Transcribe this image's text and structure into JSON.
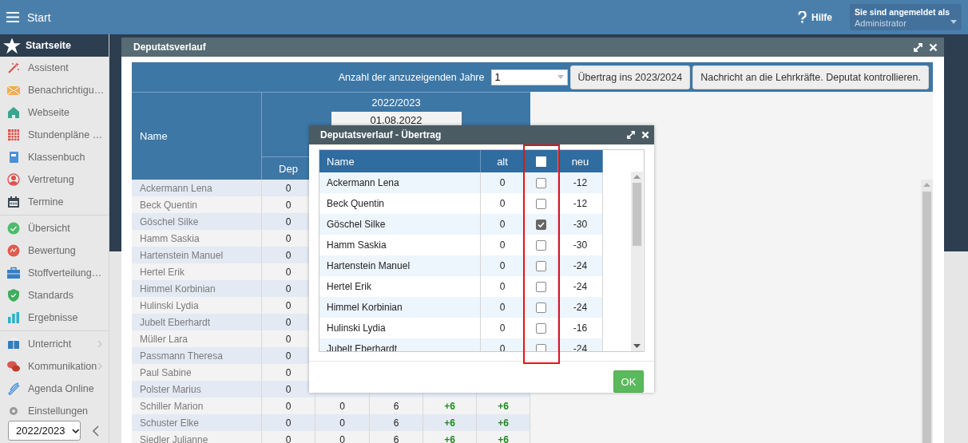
{
  "top_bar": {
    "title": "Start",
    "help": "Hilfe",
    "user_label": "Sie sind angemeldet als",
    "user_name": "Administrator"
  },
  "sidebar": {
    "groups": [
      [
        {
          "label": "Startseite",
          "selected": true,
          "has_submenu": false
        }
      ],
      [
        {
          "label": "Assistent",
          "selected": false,
          "has_submenu": false
        },
        {
          "label": "Benachrichtigu…",
          "selected": false,
          "has_submenu": false
        },
        {
          "label": "Webseite",
          "selected": false,
          "has_submenu": false
        },
        {
          "label": "Stundenpläne …",
          "selected": false,
          "has_submenu": false
        },
        {
          "label": "Klassenbuch",
          "selected": false,
          "has_submenu": false
        },
        {
          "label": "Vertretung",
          "selected": false,
          "has_submenu": false
        },
        {
          "label": "Termine",
          "selected": false,
          "has_submenu": false
        }
      ],
      [
        {
          "label": "Übersicht",
          "selected": false,
          "has_submenu": false
        },
        {
          "label": "Bewertung",
          "selected": false,
          "has_submenu": false
        },
        {
          "label": "Stoffverteilung…",
          "selected": false,
          "has_submenu": false
        },
        {
          "label": "Standards",
          "selected": false,
          "has_submenu": false
        },
        {
          "label": "Ergebnisse",
          "selected": false,
          "has_submenu": false
        }
      ],
      [
        {
          "label": "Unterricht",
          "selected": false,
          "has_submenu": true
        },
        {
          "label": "Kommunikation",
          "selected": false,
          "has_submenu": true
        },
        {
          "label": "Agenda Online",
          "selected": false,
          "has_submenu": false
        },
        {
          "label": "Einstellungen",
          "selected": false,
          "has_submenu": false
        }
      ]
    ],
    "year_select": "2022/2023"
  },
  "window": {
    "title": "Deputatsverlauf",
    "toolbar": {
      "years_label": "Anzahl der anzuzeigenden Jahre",
      "years_value": "1",
      "buttons": [
        "Übertrag ins 2023/2024",
        "Nachricht an die Lehrkräfte. Deputat kontrollieren."
      ]
    },
    "table": {
      "name_header": "Name",
      "year": "2022/2023",
      "date": "01.08.2022",
      "sub_header": "Dep",
      "rows": [
        {
          "name": "Ackermann Lena",
          "cells": [
            {
              "text": "0",
              "kind": "number"
            }
          ]
        },
        {
          "name": "Beck Quentin",
          "cells": [
            {
              "text": "0",
              "kind": "number"
            }
          ]
        },
        {
          "name": "Göschel Silke",
          "cells": [
            {
              "text": "0",
              "kind": "number"
            }
          ]
        },
        {
          "name": "Hamm Saskia",
          "cells": [
            {
              "text": "0",
              "kind": "number"
            }
          ]
        },
        {
          "name": "Hartenstein Manuel",
          "cells": [
            {
              "text": "0",
              "kind": "number"
            }
          ]
        },
        {
          "name": "Hertel Erik",
          "cells": [
            {
              "text": "0",
              "kind": "number"
            }
          ]
        },
        {
          "name": "Himmel Korbinian",
          "cells": [
            {
              "text": "0",
              "kind": "number"
            }
          ]
        },
        {
          "name": "Hulinski Lydia",
          "cells": [
            {
              "text": "0",
              "kind": "number"
            }
          ]
        },
        {
          "name": "Jubelt Eberhardt",
          "cells": [
            {
              "text": "0",
              "kind": "number"
            }
          ]
        },
        {
          "name": "Müller Lara",
          "cells": [
            {
              "text": "0",
              "kind": "number"
            }
          ]
        },
        {
          "name": "Passmann Theresa",
          "cells": [
            {
              "text": "0",
              "kind": "number"
            }
          ]
        },
        {
          "name": "Paul Sabine",
          "cells": [
            {
              "text": "0",
              "kind": "number"
            }
          ]
        },
        {
          "name": "Polster Marius",
          "cells": [
            {
              "text": "0",
              "kind": "number"
            }
          ]
        },
        {
          "name": "Schiller Marion",
          "cells": [
            {
              "text": "0",
              "kind": "number"
            },
            {
              "text": "0",
              "kind": "number"
            },
            {
              "text": "6",
              "kind": "number"
            },
            {
              "text": "+6",
              "kind": "delta"
            },
            {
              "text": "+6",
              "kind": "delta"
            }
          ]
        },
        {
          "name": "Schuster Elke",
          "cells": [
            {
              "text": "0",
              "kind": "number"
            },
            {
              "text": "0",
              "kind": "number"
            },
            {
              "text": "6",
              "kind": "number"
            },
            {
              "text": "+6",
              "kind": "delta"
            },
            {
              "text": "+6",
              "kind": "delta"
            }
          ]
        },
        {
          "name": "Siedler Julianne",
          "cells": [
            {
              "text": "0",
              "kind": "number"
            },
            {
              "text": "0",
              "kind": "number"
            },
            {
              "text": "6",
              "kind": "number"
            },
            {
              "text": "+6",
              "kind": "delta"
            },
            {
              "text": "+6",
              "kind": "delta"
            }
          ]
        }
      ]
    }
  },
  "dialog": {
    "title": "Deputatsverlauf - Übertrag",
    "columns": {
      "name": "Name",
      "old": "alt",
      "new": "neu"
    },
    "select_all_checked": false,
    "rows": [
      {
        "name": "Ackermann Lena",
        "alt": "0",
        "checked": false,
        "neu": "-12"
      },
      {
        "name": "Beck Quentin",
        "alt": "0",
        "checked": false,
        "neu": "-12"
      },
      {
        "name": "Göschel Silke",
        "alt": "0",
        "checked": true,
        "neu": "-30"
      },
      {
        "name": "Hamm Saskia",
        "alt": "0",
        "checked": false,
        "neu": "-30"
      },
      {
        "name": "Hartenstein Manuel",
        "alt": "0",
        "checked": false,
        "neu": "-24"
      },
      {
        "name": "Hertel Erik",
        "alt": "0",
        "checked": false,
        "neu": "-24"
      },
      {
        "name": "Himmel Korbinian",
        "alt": "0",
        "checked": false,
        "neu": "-24"
      },
      {
        "name": "Hulinski Lydia",
        "alt": "0",
        "checked": false,
        "neu": "-16"
      },
      {
        "name": "Jubelt Eberhardt",
        "alt": "0",
        "checked": false,
        "neu": "-24"
      }
    ],
    "ok": "OK"
  }
}
